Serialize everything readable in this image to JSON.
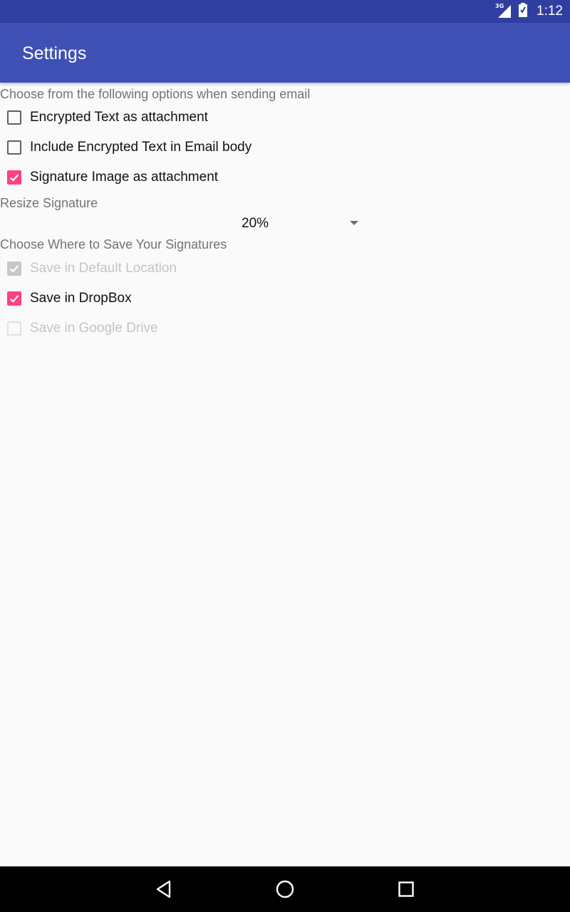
{
  "status_bar": {
    "network_label": "3G",
    "time": "1:12",
    "icons": [
      "signal-icon",
      "battery-icon"
    ]
  },
  "app_bar": {
    "title": "Settings"
  },
  "email_options": {
    "label": "Choose from the following options when sending email",
    "items": [
      {
        "label": "Encrypted Text as attachment",
        "checked": false,
        "enabled": true
      },
      {
        "label": "Include Encrypted Text in Email body",
        "checked": false,
        "enabled": true
      },
      {
        "label": "Signature Image as attachment",
        "checked": true,
        "enabled": true
      }
    ]
  },
  "resize": {
    "label": "Resize Signature",
    "selected_value": "20%"
  },
  "save_options": {
    "label": "Choose Where to Save Your Signatures",
    "items": [
      {
        "label": "Save in Default Location",
        "checked": true,
        "enabled": false
      },
      {
        "label": "Save in DropBox",
        "checked": true,
        "enabled": true
      },
      {
        "label": "Save in Google Drive",
        "checked": false,
        "enabled": false
      }
    ]
  },
  "nav_bar": {
    "icons": [
      "back-icon",
      "home-icon",
      "recents-icon"
    ]
  },
  "colors": {
    "status_bar": "#303f9f",
    "app_bar": "#3f51b5",
    "accent": "#ff4081",
    "background": "#fafafa"
  }
}
